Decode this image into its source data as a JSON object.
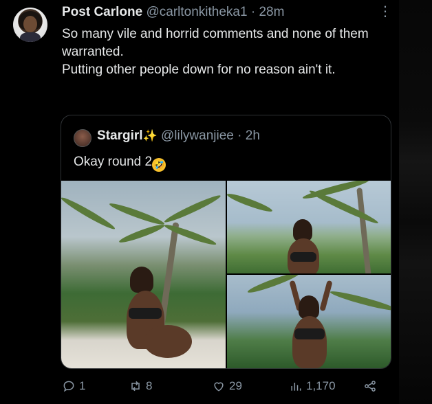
{
  "tweet": {
    "author_name": "Post Carlone",
    "author_handle": "@carltonkitheka1",
    "separator": "·",
    "time": "28m",
    "more_icon": "⋮",
    "text_line1": "So many vile and horrid comments and none of them warranted.",
    "text_line2": "Putting other people down for no reason ain't it."
  },
  "quote": {
    "author_name": "Stargirl",
    "sparkle": "✨",
    "author_handle": "@lilywanjiee",
    "separator": "·",
    "time": "2h",
    "text": "Okay round 2",
    "emoji": "rolling-on-floor-laughing-emoji"
  },
  "actions": {
    "replies": "1",
    "retweets": "8",
    "likes": "29",
    "views": "1,170"
  },
  "icons": [
    "reply-icon",
    "retweet-icon",
    "like-icon",
    "views-icon",
    "share-icon"
  ]
}
